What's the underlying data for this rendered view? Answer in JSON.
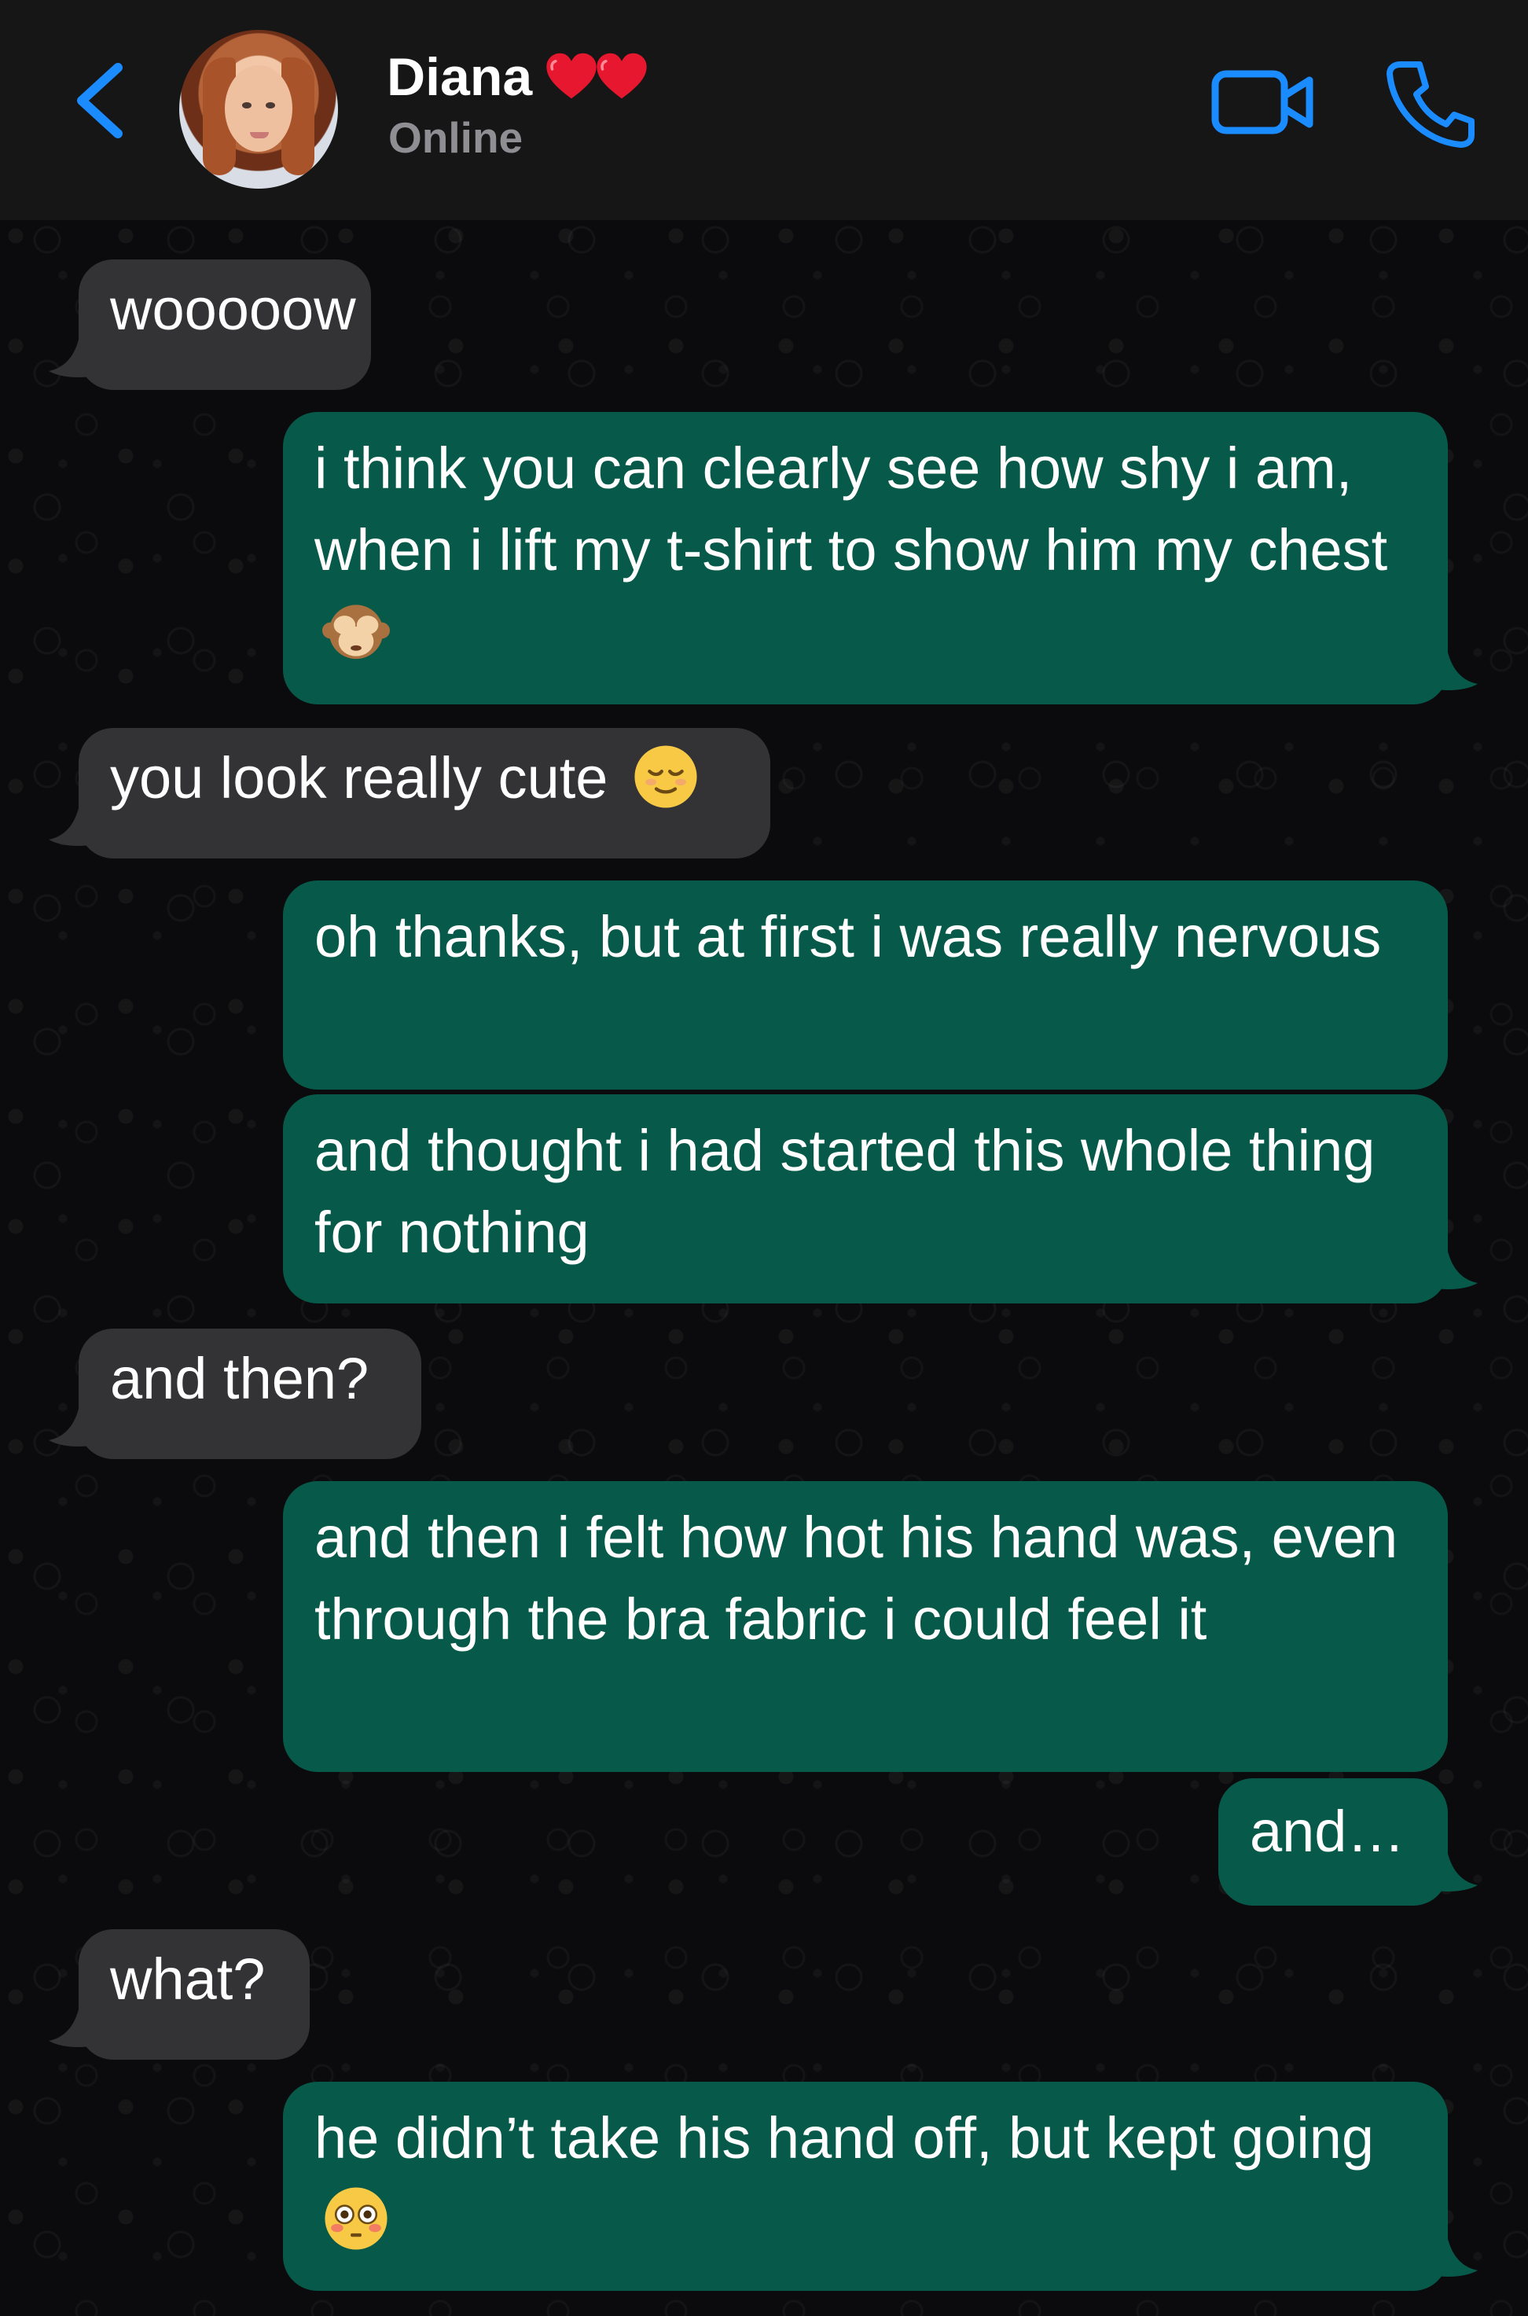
{
  "header": {
    "contact_name": "Diana",
    "name_emoji": "❤️❤️",
    "status": "Online",
    "icons": {
      "back": "chevron-left-icon",
      "video": "video-camera-icon",
      "call": "phone-icon"
    },
    "accent_color": "#1a8cff"
  },
  "messages": [
    {
      "direction": "incoming",
      "text": "wooooow"
    },
    {
      "direction": "outgoing",
      "text": "i think you can clearly see how shy i am, when i lift my t-shirt to show him my chest",
      "emoji": "🙈"
    },
    {
      "direction": "incoming",
      "text": "you look really cute",
      "emoji": "😌"
    },
    {
      "direction": "outgoing",
      "text": "oh thanks, but at first i was really nervous"
    },
    {
      "direction": "outgoing",
      "text": "and thought i had started this whole thing for nothing"
    },
    {
      "direction": "incoming",
      "text": "and then?"
    },
    {
      "direction": "outgoing",
      "text": "and then i felt how hot his hand was, even through the bra fabric i could feel it"
    },
    {
      "direction": "outgoing",
      "text": "and…"
    },
    {
      "direction": "incoming",
      "text": "what?"
    },
    {
      "direction": "outgoing",
      "text": "he didn’t take his hand off, but kept going",
      "emoji": "😳"
    }
  ],
  "colors": {
    "incoming_bubble": "#333336",
    "outgoing_bubble": "#075a49",
    "header_bg": "#161617",
    "chat_bg": "#0b0b0d"
  }
}
